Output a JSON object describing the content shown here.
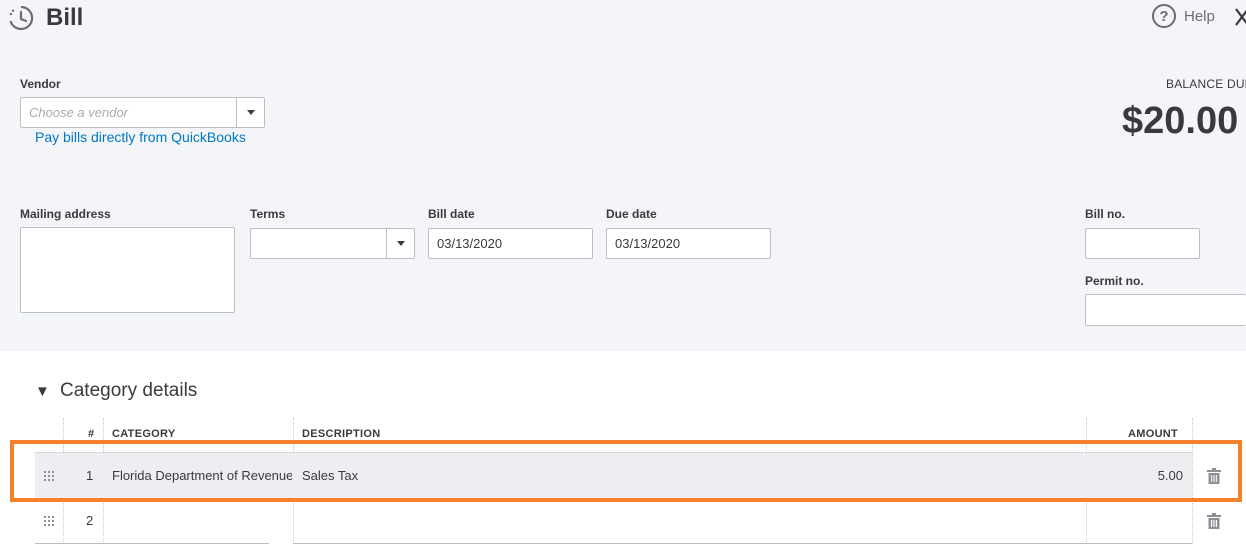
{
  "header": {
    "title": "Bill",
    "help_label": "Help"
  },
  "vendor": {
    "label": "Vendor",
    "placeholder": "Choose a vendor",
    "pay_link": "Pay bills directly from QuickBooks"
  },
  "balance": {
    "label": "BALANCE DUE",
    "amount": "$20.00"
  },
  "fields": {
    "mailing_label": "Mailing address",
    "mailing_value": "",
    "terms_label": "Terms",
    "terms_value": "",
    "bill_date_label": "Bill date",
    "bill_date_value": "03/13/2020",
    "due_date_label": "Due date",
    "due_date_value": "03/13/2020",
    "bill_no_label": "Bill no.",
    "bill_no_value": "",
    "permit_no_label": "Permit no.",
    "permit_no_value": ""
  },
  "category_details": {
    "toggle": "▼",
    "title": "Category details",
    "columns": {
      "num": "#",
      "category": "CATEGORY",
      "description": "DESCRIPTION",
      "amount": "AMOUNT"
    },
    "rows": [
      {
        "num": "1",
        "category": "Florida Department of Revenue",
        "description": "Sales Tax",
        "amount": "5.00"
      },
      {
        "num": "2",
        "category": "",
        "description": "",
        "amount": ""
      }
    ]
  },
  "colors": {
    "page_bg": "#f4f5f8",
    "link": "#0077c5",
    "highlight": "#f5822a",
    "text": "#393a3d"
  },
  "icons": [
    "bill-history-icon",
    "help-icon",
    "close-icon",
    "chevron-down-icon",
    "drag-handle-icon",
    "trash-icon",
    "collapse-triangle-icon"
  ]
}
